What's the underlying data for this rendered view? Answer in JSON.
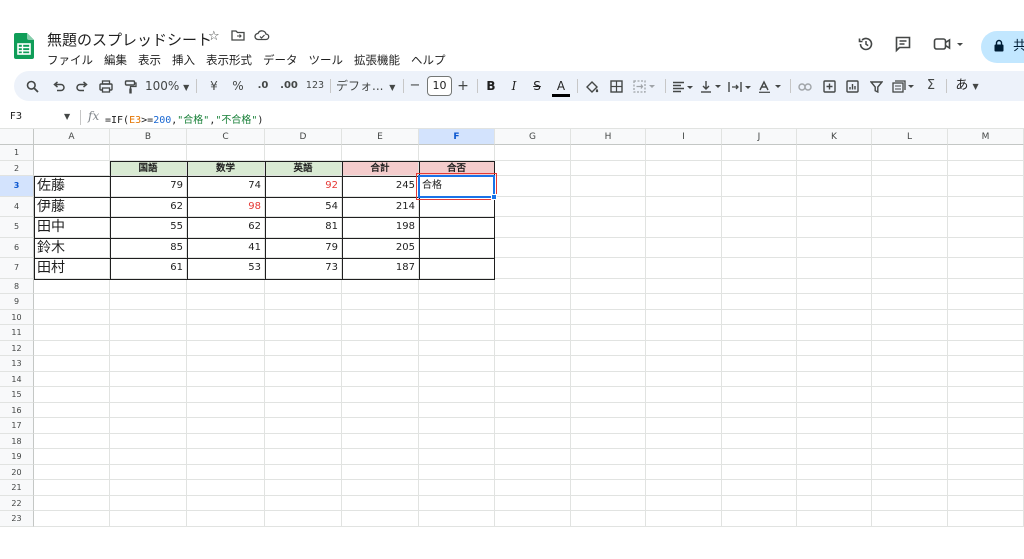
{
  "doc": {
    "title": "無題のスプレッドシート",
    "menus": [
      "ファイル",
      "編集",
      "表示",
      "挿入",
      "表示形式",
      "データ",
      "ツール",
      "拡張機能",
      "ヘルプ"
    ],
    "share_label": "共"
  },
  "toolbar": {
    "zoom": "100%",
    "currency": "¥",
    "percent": "%",
    "dec_decrease": ".0",
    "dec_increase": ".00",
    "number_format": "123",
    "font": "デフォ...",
    "font_size": "10",
    "minus": "−",
    "plus": "+",
    "bold": "B",
    "italic": "I",
    "strike": "S",
    "text_color": "A",
    "sigma": "Σ",
    "input_mode": "あ"
  },
  "formula_bar": {
    "cell_ref": "F3",
    "fx": "fx",
    "f_prefix": "=IF(",
    "f_ref": "E3",
    "f_op": ">=",
    "f_num": "200",
    "f_comma1": ",",
    "f_true": "\"合格\"",
    "f_comma2": ",",
    "f_false": "\"不合格\"",
    "f_end": ")"
  },
  "grid": {
    "columns": [
      "A",
      "B",
      "C",
      "D",
      "E",
      "F",
      "G",
      "H",
      "I",
      "J",
      "K",
      "L",
      "M"
    ],
    "rows": [
      "1",
      "2",
      "3",
      "4",
      "5",
      "6",
      "7",
      "8",
      "9",
      "10",
      "11",
      "12",
      "13",
      "14",
      "15",
      "16",
      "17",
      "18",
      "19",
      "20",
      "21",
      "22",
      "23"
    ],
    "selected_column": "F",
    "selected_row": "3"
  },
  "table": {
    "headers": [
      "国語",
      "数学",
      "英語",
      "合計",
      "合否"
    ],
    "header_colors": [
      "#d9ead3",
      "#d9ead3",
      "#d9ead3",
      "#f4cccc",
      "#f4cccc"
    ],
    "highlight_color": "#e53935",
    "rows": [
      {
        "name": "佐藤",
        "values": [
          "79",
          "74",
          "92",
          "245"
        ],
        "result": "合格",
        "red": [
          2
        ]
      },
      {
        "name": "伊藤",
        "values": [
          "62",
          "98",
          "54",
          "214"
        ],
        "result": "",
        "red": [
          1
        ]
      },
      {
        "name": "田中",
        "values": [
          "55",
          "62",
          "81",
          "198"
        ],
        "result": "",
        "red": []
      },
      {
        "name": "鈴木",
        "values": [
          "85",
          "41",
          "79",
          "205"
        ],
        "result": "",
        "red": []
      },
      {
        "name": "田村",
        "values": [
          "61",
          "53",
          "73",
          "187"
        ],
        "result": "",
        "red": []
      }
    ]
  }
}
